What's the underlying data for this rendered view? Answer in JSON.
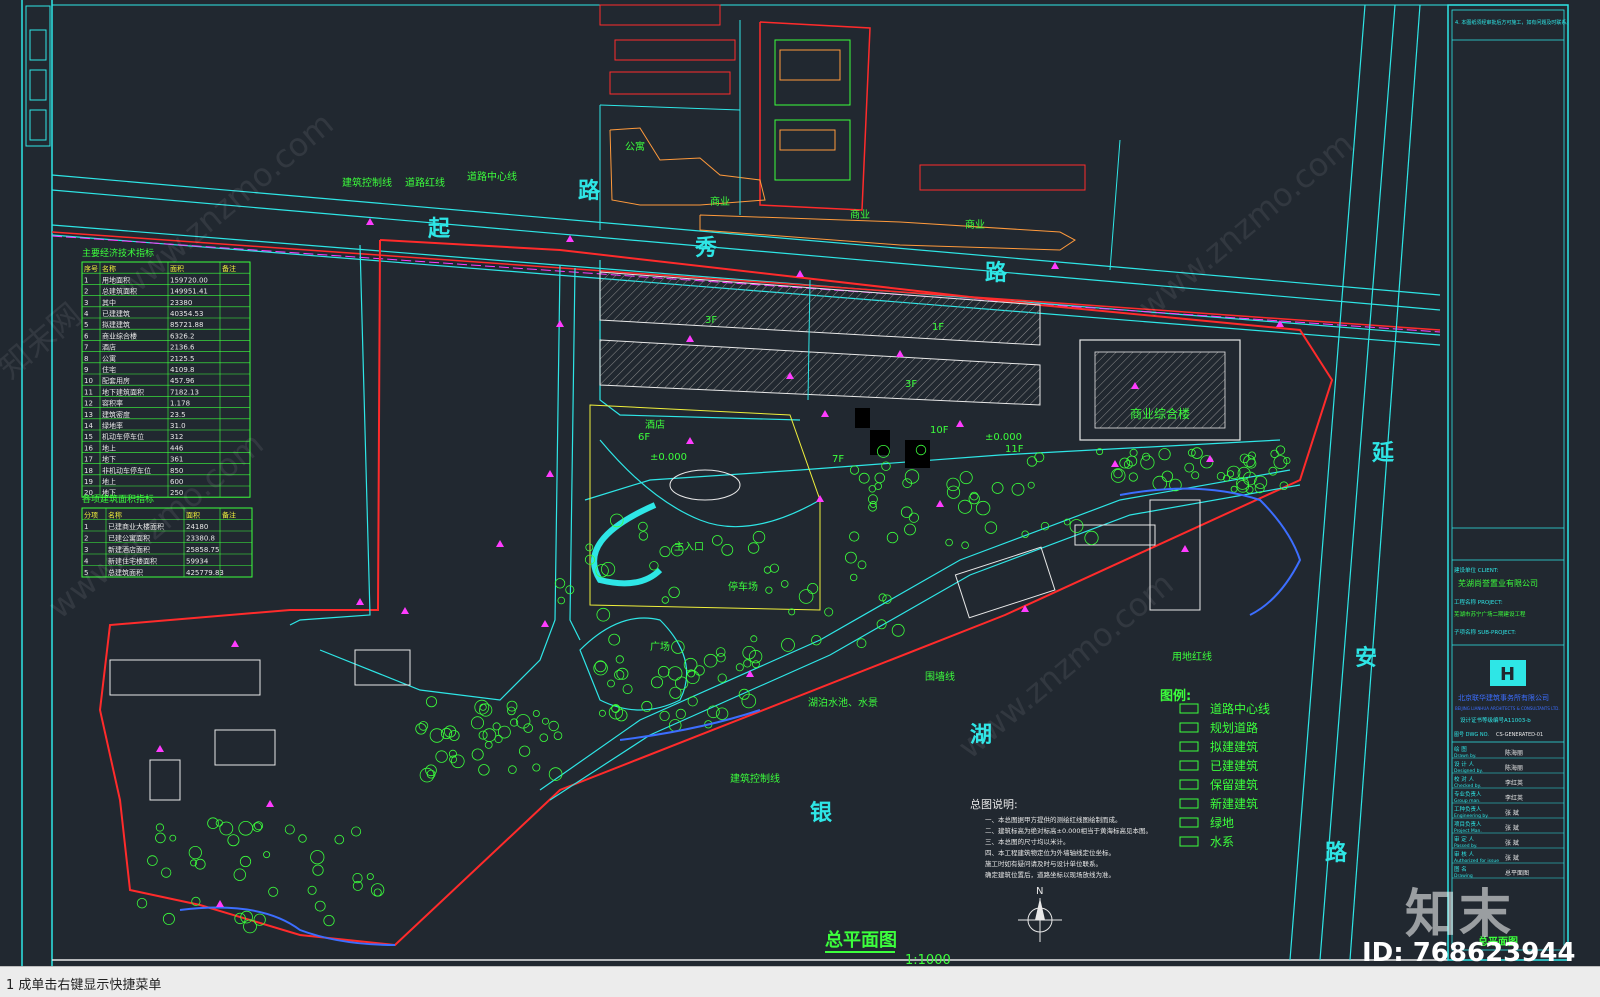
{
  "drawing": {
    "title": "总平面图",
    "scale": "1:1000",
    "header_note": "4. 本图纸须经审批后方可施工，如有问题及时联系。"
  },
  "roads": {
    "road_north_1": "路",
    "road_north_2": "秀",
    "road_north_3": "路",
    "road_west": "起",
    "road_east_1": "延",
    "road_east_2": "安",
    "road_east_3": "路",
    "lake_1": "湖",
    "lake_2": "银"
  },
  "annotations": {
    "building_control_line": "建筑控制线",
    "road_red_line": "道路红线",
    "road_center_line": "道路中心线",
    "commercial_complex": "商业综合楼",
    "wall_line": "围墙线",
    "control_line_2": "建筑控制线",
    "water_features": "湖泊水池、水景",
    "land_red_line": "用地红线",
    "bldg_3f": "3F",
    "bldg_1f": "1F",
    "bldg_6f": "6F",
    "bldg_10f": "10F",
    "bldg_11f": "11F",
    "bldg_7f": "7F",
    "elev_1": "±0.000",
    "elev_2": "±0.000",
    "main_entrance": "主入口",
    "plaza": "广场",
    "hotel": "酒店",
    "shop_1": "商业",
    "shop_2": "商业",
    "shop_3": "商业",
    "apartment": "公寓",
    "parking": "停车场"
  },
  "indicator_table": {
    "title": "主要经济技术指标",
    "headers": [
      "序号",
      "名称",
      "面积",
      "备注"
    ],
    "rows": [
      [
        "1",
        "用地面积",
        "159720.00",
        ""
      ],
      [
        "2",
        "总建筑面积",
        "149951.41",
        ""
      ],
      [
        "3",
        "其中",
        "23380",
        ""
      ],
      [
        "4",
        "已建建筑",
        "40354.53",
        ""
      ],
      [
        "5",
        "拟建建筑",
        "85721.88",
        ""
      ],
      [
        "6",
        "商业综合楼",
        "6326.2",
        ""
      ],
      [
        "7",
        "酒店",
        "2136.6",
        ""
      ],
      [
        "8",
        "公寓",
        "2125.5",
        ""
      ],
      [
        "9",
        "住宅",
        "4109.8",
        ""
      ],
      [
        "10",
        "配套用房",
        "457.96",
        ""
      ],
      [
        "11",
        "地下建筑面积",
        "7182.13",
        ""
      ],
      [
        "12",
        "容积率",
        "1.178",
        ""
      ],
      [
        "13",
        "建筑密度",
        "23.5",
        ""
      ],
      [
        "14",
        "绿地率",
        "31.0",
        ""
      ],
      [
        "15",
        "机动车停车位",
        "312",
        ""
      ],
      [
        "16",
        "地上",
        "446",
        ""
      ],
      [
        "17",
        "地下",
        "361",
        ""
      ],
      [
        "18",
        "非机动车停车位",
        "850",
        ""
      ],
      [
        "19",
        "地上",
        "600",
        ""
      ],
      [
        "20",
        "地下",
        "250",
        ""
      ]
    ]
  },
  "area_table": {
    "title": "各项建筑面积指标",
    "headers": [
      "分项",
      "名称",
      "面积",
      "备注"
    ],
    "rows": [
      [
        "1",
        "已建商业大楼面积",
        "24180",
        ""
      ],
      [
        "2",
        "已建公寓面积",
        "23380.8",
        ""
      ],
      [
        "3",
        "新建酒店面积",
        "25858.75",
        ""
      ],
      [
        "4",
        "新建住宅楼面积",
        "59934",
        ""
      ],
      [
        "5",
        "总建筑面积",
        "425779.83",
        ""
      ]
    ]
  },
  "legend": {
    "title": "图例:",
    "items": [
      {
        "icon": "road-center-icon",
        "label": "道路中心线"
      },
      {
        "icon": "planned-road-icon",
        "label": "规划道路"
      },
      {
        "icon": "proposed-building-icon",
        "label": "拟建建筑"
      },
      {
        "icon": "built-building-icon",
        "label": "已建建筑"
      },
      {
        "icon": "retained-building-icon",
        "label": "保留建筑"
      },
      {
        "icon": "new-building-icon",
        "label": "新建建筑"
      },
      {
        "icon": "green-icon",
        "label": "绿地"
      },
      {
        "icon": "water-icon",
        "label": "水系"
      }
    ]
  },
  "notes": {
    "title": "总图说明:",
    "lines": [
      "一、本总图据甲方提供的测绘红线图绘制而成。",
      "二、建筑标高为绝对标高±0.000相当于黄海标高见本图。",
      "三、本总图的尺寸均以米计。",
      "四、本工程建筑物定位为外墙轴线定位坐标。",
      "    施工时如有疑问请及时与设计单位联系。",
      "    确定建筑位置后，道路坐标以现场放线为准。"
    ]
  },
  "title_block": {
    "client_label": "建设单位 CLIENT:",
    "client": "芜湖尚誉置业有限公司",
    "project_label": "工程名称 PROJECT:",
    "project": "芜湖市苏宁广场二期建设工程",
    "sub_label": "子项名称 SUB-PROJECT:",
    "firm": "北京联华建筑事务所有限公司",
    "firm_en": "BEIJING LIANHUA ARCHITECTS & CONSULTANTS LTD.",
    "cert": "设计证书等级编号A11003-b",
    "drawing_no_label": "图号 DWG NO.",
    "drawing_no": "CS-GENERATED-01",
    "roles": [
      {
        "cn": "绘 图",
        "en": "Drawn by.",
        "name": "陈海丽"
      },
      {
        "cn": "设 计 人",
        "en": "Designed by.",
        "name": "陈海丽"
      },
      {
        "cn": "校 对 人",
        "en": "Checked by.",
        "name": "李红英"
      },
      {
        "cn": "专业负责人",
        "en": "Group man.",
        "name": "李红英"
      },
      {
        "cn": "工种负责人",
        "en": "Engineering by.",
        "name": "张 斌"
      },
      {
        "cn": "项目负责人",
        "en": "Project Man.",
        "name": "张 斌"
      },
      {
        "cn": "审 定 人",
        "en": "Passed by.",
        "name": "张 斌"
      },
      {
        "cn": "审 核 人",
        "en": "Authorized for issue",
        "name": "张 斌"
      },
      {
        "cn": "图 名",
        "en": "Drawing",
        "name": "总平面图"
      }
    ],
    "sheet_title": "总平面图"
  },
  "compass": {
    "label": "N"
  },
  "watermark": {
    "logo": "知末",
    "id": "ID: 768623944",
    "site": "www.znzmo.com",
    "site_cn": "知末网"
  },
  "statusbar": {
    "command_text": "1   成单击右键显示快捷菜单"
  },
  "colors": {
    "background": "#212830",
    "red_line": "#ff2b2b",
    "cyan": "#2ee6e6",
    "green": "#3cff3c",
    "magenta": "#ff3cff",
    "white": "#e8e8e8",
    "yellow": "#f0f03c",
    "orange": "#ff9a3c",
    "blue": "#3c6eff"
  }
}
